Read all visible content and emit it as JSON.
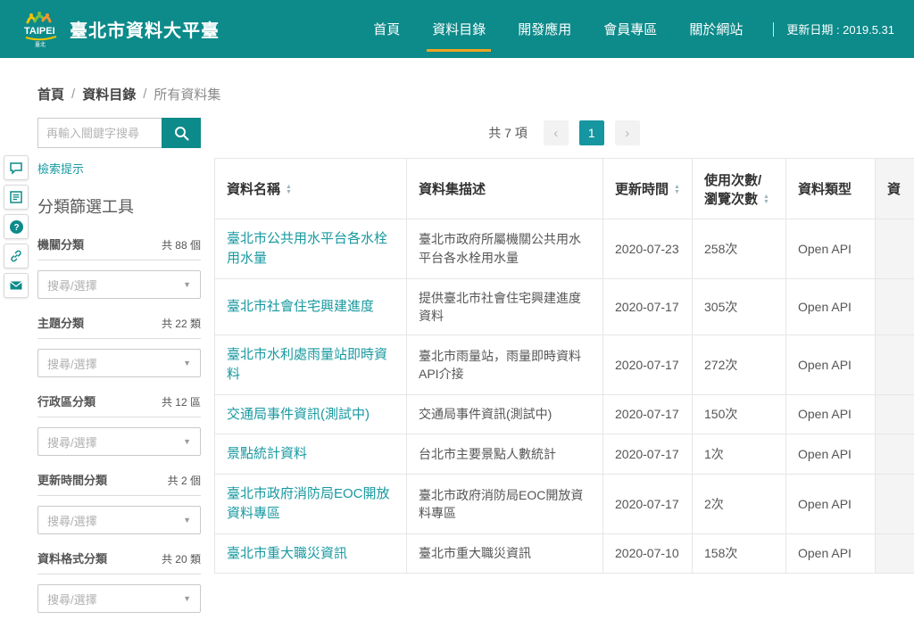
{
  "accent": "#0d8a8a",
  "header": {
    "logo": "TAIPEI",
    "title": "臺北市資料大平臺",
    "nav": [
      {
        "label": "首頁",
        "active": false
      },
      {
        "label": "資料目錄",
        "active": true
      },
      {
        "label": "開發應用",
        "active": false
      },
      {
        "label": "會員專區",
        "active": false
      },
      {
        "label": "關於網站",
        "active": false
      }
    ],
    "update_date": "更新日期 : 2019.5.31"
  },
  "breadcrumb": {
    "items": [
      "首頁",
      "資料目錄",
      "所有資料集"
    ],
    "separator": "/"
  },
  "side_toolbar": {
    "icons": [
      "chat-icon",
      "form-icon",
      "question-icon",
      "link-icon",
      "mail-icon"
    ]
  },
  "sidebar": {
    "search_placeholder": "再輸入關鍵字搜尋",
    "hint_link": "檢索提示",
    "filter_title": "分類篩選工具",
    "select_placeholder": "搜尋/選擇",
    "filters": [
      {
        "label": "機關分類",
        "count": "共 88 個"
      },
      {
        "label": "主題分類",
        "count": "共 22 類"
      },
      {
        "label": "行政區分類",
        "count": "共 12 區"
      },
      {
        "label": "更新時間分類",
        "count": "共 2 個"
      },
      {
        "label": "資料格式分類",
        "count": "共 20 類"
      }
    ]
  },
  "results": {
    "total": "共 7 項",
    "pagination": {
      "prev": "‹",
      "current": "1",
      "next": "›"
    },
    "table": {
      "columns": [
        {
          "label": "資料名稱",
          "sortable": true
        },
        {
          "label": "資料集描述",
          "sortable": false
        },
        {
          "label": "更新時間",
          "sortable": true
        },
        {
          "label": "使用次數/瀏覽次數",
          "sortable": true
        },
        {
          "label": "資料類型",
          "sortable": false
        },
        {
          "label": "資",
          "sortable": false
        }
      ],
      "rows": [
        {
          "name": "臺北市公共用水平台各水栓用水量",
          "description": "臺北市政府所屬機關公共用水平台各水栓用水量",
          "updated": "2020-07-23",
          "usage": "258次",
          "type": "Open API"
        },
        {
          "name": "臺北市社會住宅興建進度",
          "description": "提供臺北市社會住宅興建進度資料",
          "updated": "2020-07-17",
          "usage": "305次",
          "type": "Open API"
        },
        {
          "name": "臺北市水利處雨量站即時資料",
          "description": "臺北市雨量站，雨量即時資料API介接",
          "updated": "2020-07-17",
          "usage": "272次",
          "type": "Open API"
        },
        {
          "name": "交通局事件資訊(測試中)",
          "description": "交通局事件資訊(測試中)",
          "updated": "2020-07-17",
          "usage": "150次",
          "type": "Open API"
        },
        {
          "name": "景點統計資料",
          "description": "台北市主要景點人數統計",
          "updated": "2020-07-17",
          "usage": "1次",
          "type": "Open API"
        },
        {
          "name": "臺北市政府消防局EOC開放資料專區",
          "description": "臺北市政府消防局EOC開放資料專區",
          "updated": "2020-07-17",
          "usage": "2次",
          "type": "Open API"
        },
        {
          "name": "臺北市重大職災資訊",
          "description": "臺北市重大職災資訊",
          "updated": "2020-07-10",
          "usage": "158次",
          "type": "Open API"
        }
      ]
    }
  }
}
